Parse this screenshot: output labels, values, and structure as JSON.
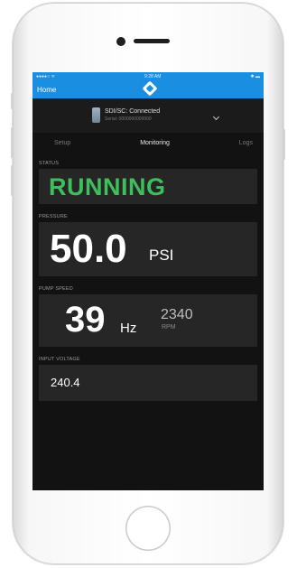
{
  "status_bar": {
    "carrier": "●●●●○ ᯤ",
    "time": "9:28 AM",
    "battery": "✱ ▬"
  },
  "nav": {
    "home_label": "Home",
    "logo_icon": "diamond-logo-icon"
  },
  "device": {
    "name": "SDI/SC: Connected",
    "serial": "Serial: 0000000000000"
  },
  "tabs": [
    {
      "label": "Setup",
      "active": false
    },
    {
      "label": "Monitoring",
      "active": true
    },
    {
      "label": "Logs",
      "active": false
    }
  ],
  "status": {
    "label": "STATUS",
    "value": "RUNNING",
    "color": "#3dbf5a"
  },
  "pressure": {
    "label": "PRESSURE",
    "value": "50.0",
    "unit": "PSI"
  },
  "pump_speed": {
    "label": "PUMP SPEED",
    "value": "39",
    "unit": "Hz",
    "rpm_value": "2340",
    "rpm_unit": "RPM"
  },
  "input_voltage": {
    "label": "INPUT VOLTAGE",
    "value": "240.4"
  },
  "colors": {
    "accent": "#1a8ee0",
    "background": "#121212",
    "card": "#262626"
  }
}
